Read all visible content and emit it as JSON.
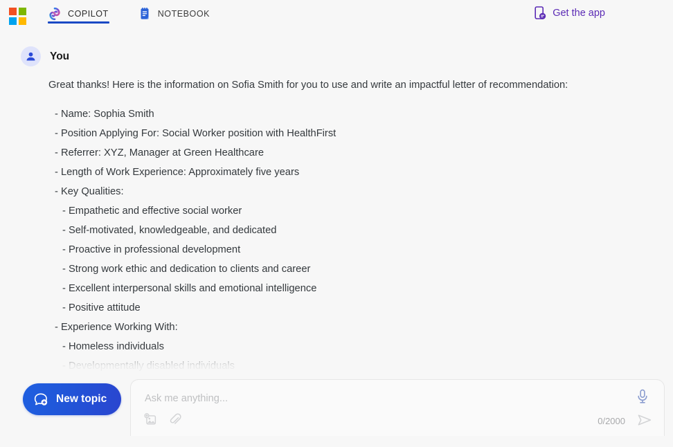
{
  "topbar": {
    "logo": {
      "name": "microsoft-logo",
      "colors": [
        "#f15022",
        "#7eb701",
        "#00a3ee",
        "#ffb900"
      ]
    },
    "tabs": [
      {
        "label": "COPILOT",
        "icon": "copilot-icon",
        "active": true
      },
      {
        "label": "NOTEBOOK",
        "icon": "notebook-icon",
        "active": false
      }
    ],
    "get_app": {
      "label": "Get the app",
      "icon": "get-app-icon",
      "color": "#5b2bb5"
    },
    "active_tab_underline_color": "#1a49c4"
  },
  "conversation": {
    "message": {
      "author": "You",
      "avatar_icon": "person-icon",
      "intro": "Great thanks! Here is the information on Sofia Smith for you to use and write an impactful letter of recommendation:",
      "lines": [
        {
          "level": 1,
          "text": "- Name: Sophia Smith"
        },
        {
          "level": 1,
          "text": "- Position Applying For: Social Worker position with HealthFirst"
        },
        {
          "level": 1,
          "text": "- Referrer: XYZ, Manager at Green Healthcare"
        },
        {
          "level": 1,
          "text": "- Length of Work Experience: Approximately five years"
        },
        {
          "level": 1,
          "text": "- Key Qualities:"
        },
        {
          "level": 2,
          "text": "- Empathetic and effective social worker"
        },
        {
          "level": 2,
          "text": "- Self-motivated, knowledgeable, and dedicated"
        },
        {
          "level": 2,
          "text": "- Proactive in professional development"
        },
        {
          "level": 2,
          "text": "- Strong work ethic and dedication to clients and career"
        },
        {
          "level": 2,
          "text": "- Excellent interpersonal skills and emotional intelligence"
        },
        {
          "level": 2,
          "text": "- Positive attitude"
        },
        {
          "level": 1,
          "text": "- Experience Working With:"
        },
        {
          "level": 2,
          "text": "- Homeless individuals"
        },
        {
          "level": 2,
          "text": "- Developmentally disabled individuals"
        }
      ]
    }
  },
  "composer": {
    "new_topic_label": "New topic",
    "new_topic_icon": "chat-plus-icon",
    "input_value": "",
    "input_placeholder": "Ask me anything...",
    "char_count": "0/2000",
    "tools": [
      {
        "name": "add-image-icon"
      },
      {
        "name": "attachment-icon"
      }
    ],
    "mic_icon": "microphone-icon",
    "send_icon": "send-icon"
  },
  "theme": {
    "background": "#f7f7f7",
    "accent_blue": "#1a49c4",
    "purple": "#5b2bb5",
    "text": "#34393d"
  }
}
